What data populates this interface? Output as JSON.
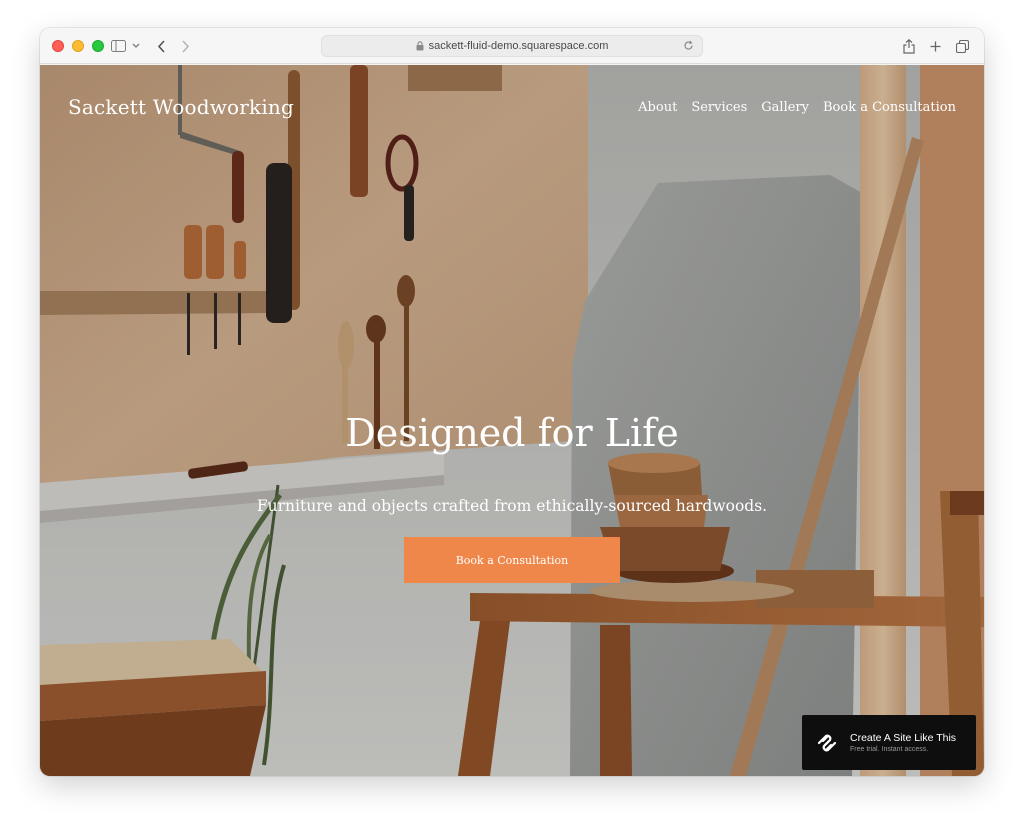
{
  "browser": {
    "url": "sackett-fluid-demo.squarespace.com"
  },
  "site": {
    "title": "Sackett Woodworking",
    "nav": [
      "About",
      "Services",
      "Gallery",
      "Book a Consultation"
    ]
  },
  "hero": {
    "headline": "Designed for Life",
    "subheadline": "Furniture and objects crafted from ethically-sourced hardwoods.",
    "cta_label": "Book a Consultation"
  },
  "badge": {
    "title": "Create A Site Like This",
    "subtitle": "Free trial. Instant access."
  },
  "colors": {
    "accent": "#f0874a",
    "badge_bg": "#0e0e0e"
  }
}
